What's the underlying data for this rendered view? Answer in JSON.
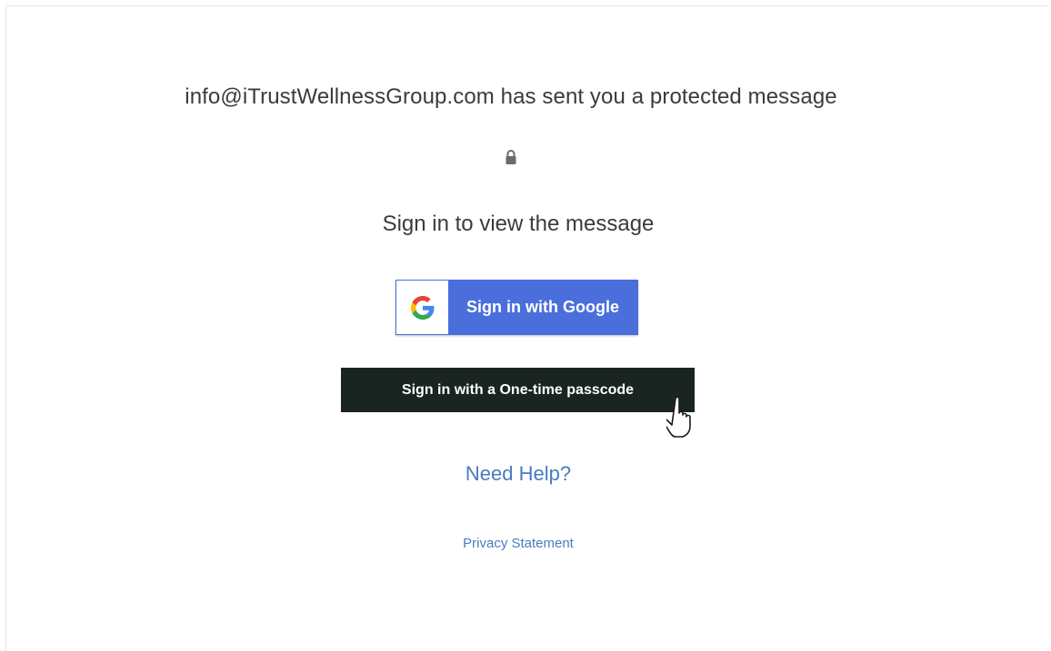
{
  "message": {
    "sender_line": "info@iTrustWellnessGroup.com has sent you a protected message",
    "lock_icon": "lock-icon",
    "heading": "Sign in to view the message"
  },
  "buttons": {
    "google_label": "Sign in with Google",
    "otp_label": "Sign in with a One-time passcode"
  },
  "links": {
    "help": "Need Help?",
    "privacy": "Privacy Statement"
  },
  "colors": {
    "google_blue": "#4a6fdc",
    "otp_dark": "#1a2420",
    "link_blue": "#4a7bbf",
    "text_gray": "#3b3b3b"
  }
}
